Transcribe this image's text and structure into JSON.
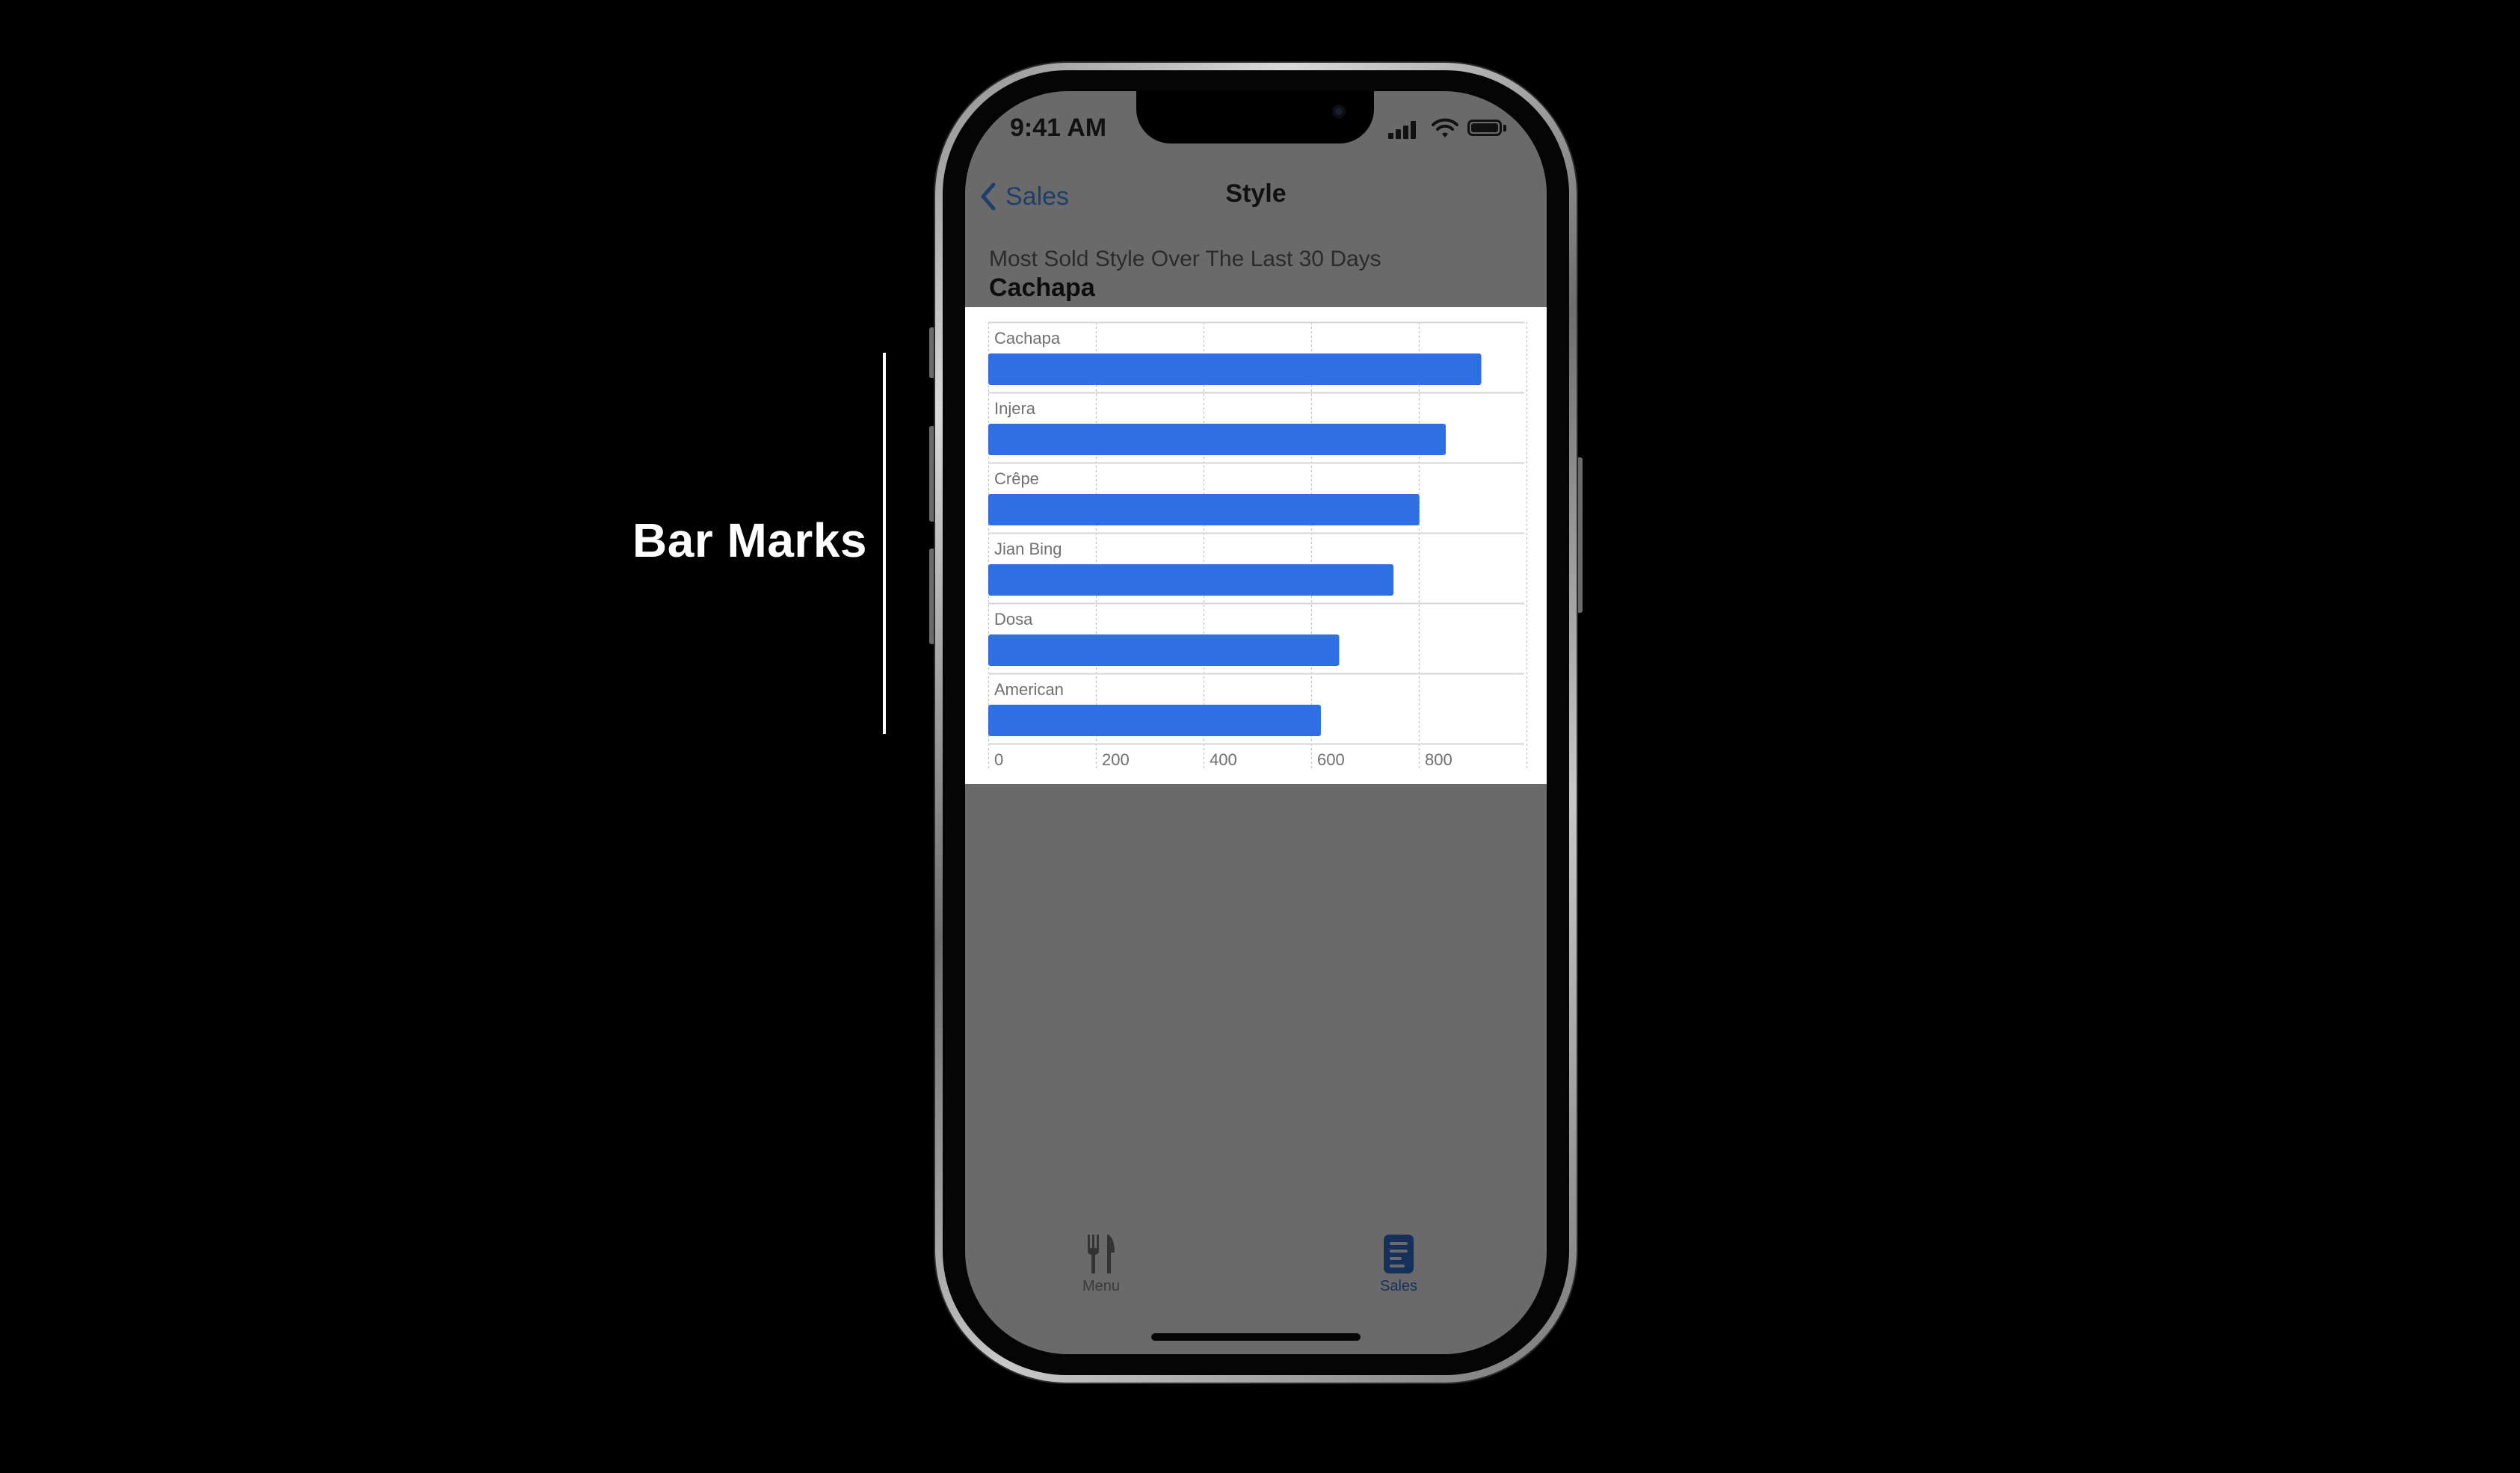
{
  "annotation": {
    "label": "Bar Marks"
  },
  "status_bar": {
    "time": "9:41 AM",
    "icons": [
      "cellular-signal-icon",
      "wifi-icon",
      "battery-icon"
    ]
  },
  "nav": {
    "back_label": "Sales",
    "back_icon": "chevron-left-icon",
    "title": "Style"
  },
  "summary": {
    "subtitle": "Most Sold Style Over The Last 30 Days",
    "headline": "Cachapa"
  },
  "colors": {
    "bar": "#2f6fe4",
    "accent": "#1e3f6a",
    "screen_dim": "#6a6a6a"
  },
  "chart_data": {
    "type": "bar",
    "orientation": "horizontal",
    "categories": [
      "Cachapa",
      "Injera",
      "Crêpe",
      "Jian Bing",
      "Dosa",
      "American"
    ],
    "values": [
      916,
      850,
      801,
      753,
      652,
      618
    ],
    "xticks": [
      "0",
      "200",
      "400",
      "600",
      "800"
    ],
    "xlim": [
      0,
      1000
    ],
    "grid": true
  },
  "tabs": [
    {
      "label": "Menu",
      "icon": "fork-knife-icon",
      "selected": false
    },
    {
      "label": "Sales",
      "icon": "document-icon",
      "selected": true
    }
  ]
}
